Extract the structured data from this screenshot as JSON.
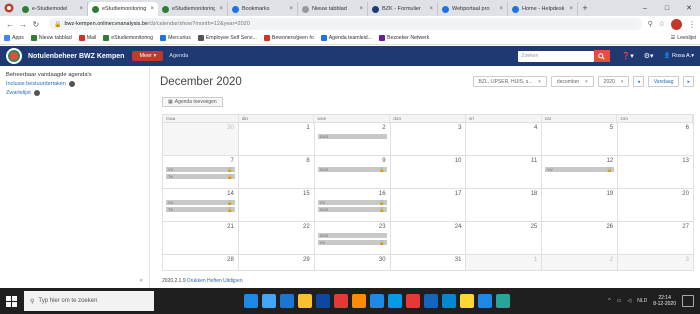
{
  "browser": {
    "tabs": [
      {
        "label": "e-Studiemodel",
        "color": "#2e7d32",
        "active": false
      },
      {
        "label": "eStudiemonitoring",
        "color": "#2e7d32",
        "active": true
      },
      {
        "label": "eStudiemonitoring",
        "color": "#2e7d32",
        "active": false
      },
      {
        "label": "Bookmarks",
        "color": "#1a73e8",
        "active": false
      },
      {
        "label": "Nieuw tabblad",
        "color": "#999999",
        "active": false
      },
      {
        "label": "BZK - Formulier",
        "color": "#1f3a73",
        "active": false
      },
      {
        "label": "Webportaal pro",
        "color": "#1a73e8",
        "active": false
      },
      {
        "label": "Home - Helpdesk",
        "color": "#1a73e8",
        "active": false
      }
    ],
    "url_host": "bwz-kempen.onlinecvnanalysis.be",
    "url_path": "/cb/calendar/show?month=12&year=2020",
    "window_controls": [
      "–",
      "□",
      "✕"
    ]
  },
  "bookmarks": {
    "items": [
      {
        "label": "Apps",
        "color": "#4285f4"
      },
      {
        "label": "Nieuw tabblad",
        "color": "#2e7d32"
      },
      {
        "label": "Mail",
        "color": "#d93025"
      },
      {
        "label": "eStudiemonitoring",
        "color": "#2e7d32"
      },
      {
        "label": "Mercurius",
        "color": "#1a73e8"
      },
      {
        "label": "Employee Self Servi...",
        "color": "#555555"
      },
      {
        "label": "Bewoners/geen fo",
        "color": "#d93025"
      },
      {
        "label": "Agenda teamleid...",
        "color": "#1a73e8"
      },
      {
        "label": "Bezoeker Netwerk",
        "color": "#6a1b9a"
      }
    ],
    "other_label": "Leeslijst"
  },
  "app": {
    "title": "Notulenbeheer BWZ Kempen",
    "menu_label": "Meer ▾",
    "nav_label": "Agenda",
    "search_placeholder": "Zoeken",
    "user_label": "Rosa A.▾"
  },
  "sidebar": {
    "title": "Beheerbaar vandaagde agenda's",
    "items": [
      {
        "label": "Inclusie bestuurdertaken"
      },
      {
        "label": "Zwartelijst"
      }
    ],
    "collapse_label": "«"
  },
  "calendar": {
    "title": "December 2020",
    "new_appointment_label": "Agenda toevoegen",
    "agenda_select": "BZL, LIPSER, HUIS, s...",
    "month_select": "december",
    "year_select": "2020",
    "today_label": "Vandaag",
    "weekdays": [
      "maa",
      "din",
      "woe",
      "don",
      "vri",
      "zat",
      "zon"
    ],
    "weeks": [
      [
        {
          "day": "30",
          "other": true,
          "events": []
        },
        {
          "day": "1",
          "other": false,
          "events": []
        },
        {
          "day": "2",
          "other": false,
          "events": [
            {
              "label": "GVS",
              "lock": false
            }
          ]
        },
        {
          "day": "3",
          "other": false,
          "events": []
        },
        {
          "day": "4",
          "other": false,
          "events": []
        },
        {
          "day": "5",
          "other": false,
          "events": []
        },
        {
          "day": "6",
          "other": false,
          "events": []
        }
      ],
      [
        {
          "day": "7",
          "other": false,
          "events": [
            {
              "label": "VV",
              "lock": true
            },
            {
              "label": "TK",
              "lock": true
            }
          ]
        },
        {
          "day": "8",
          "other": false,
          "events": []
        },
        {
          "day": "9",
          "other": false,
          "events": [
            {
              "label": "GVS",
              "lock": true
            }
          ]
        },
        {
          "day": "10",
          "other": false,
          "events": []
        },
        {
          "day": "11",
          "other": false,
          "events": []
        },
        {
          "day": "12",
          "other": false,
          "events": [
            {
              "label": "VV",
              "lock": true
            }
          ]
        },
        {
          "day": "13",
          "other": false,
          "events": []
        }
      ],
      [
        {
          "day": "14",
          "other": false,
          "events": [
            {
              "label": "VV",
              "lock": true
            },
            {
              "label": "TK",
              "lock": true
            }
          ]
        },
        {
          "day": "15",
          "other": false,
          "events": []
        },
        {
          "day": "16",
          "other": false,
          "events": [
            {
              "label": "VV",
              "lock": true
            },
            {
              "label": "GVS",
              "lock": true
            }
          ]
        },
        {
          "day": "17",
          "other": false,
          "events": []
        },
        {
          "day": "18",
          "other": false,
          "events": []
        },
        {
          "day": "19",
          "other": false,
          "events": []
        },
        {
          "day": "20",
          "other": false,
          "events": []
        }
      ],
      [
        {
          "day": "21",
          "other": false,
          "events": []
        },
        {
          "day": "22",
          "other": false,
          "events": []
        },
        {
          "day": "23",
          "other": false,
          "events": [
            {
              "label": "GVS",
              "lock": false
            },
            {
              "label": "VV",
              "lock": true
            }
          ]
        },
        {
          "day": "24",
          "other": false,
          "events": []
        },
        {
          "day": "25",
          "other": false,
          "events": []
        },
        {
          "day": "26",
          "other": false,
          "events": []
        },
        {
          "day": "27",
          "other": false,
          "events": []
        }
      ],
      [
        {
          "day": "28",
          "other": false,
          "events": []
        },
        {
          "day": "29",
          "other": false,
          "events": []
        },
        {
          "day": "30",
          "other": false,
          "events": []
        },
        {
          "day": "31",
          "other": false,
          "events": []
        },
        {
          "day": "1",
          "other": true,
          "events": []
        },
        {
          "day": "2",
          "other": true,
          "events": []
        },
        {
          "day": "3",
          "other": true,
          "events": []
        }
      ]
    ],
    "version": "2020.2.1.9",
    "version_link": "Drukken Heften Uitdijpen"
  },
  "taskbar": {
    "search_placeholder": "Typ hier om te zoeken",
    "apps": [
      "#1e88e5",
      "#42a5f5",
      "#1976d2",
      "#fbc02d",
      "#0d47a1",
      "#e53935",
      "#fb8c00",
      "#1e88e5",
      "#039be5",
      "#e53935",
      "#1565c0",
      "#0288d1",
      "#fdd835",
      "#1e88e5",
      "#26a69a"
    ],
    "time": "22:14",
    "date": "8-12-2020",
    "lang": "NLD"
  }
}
